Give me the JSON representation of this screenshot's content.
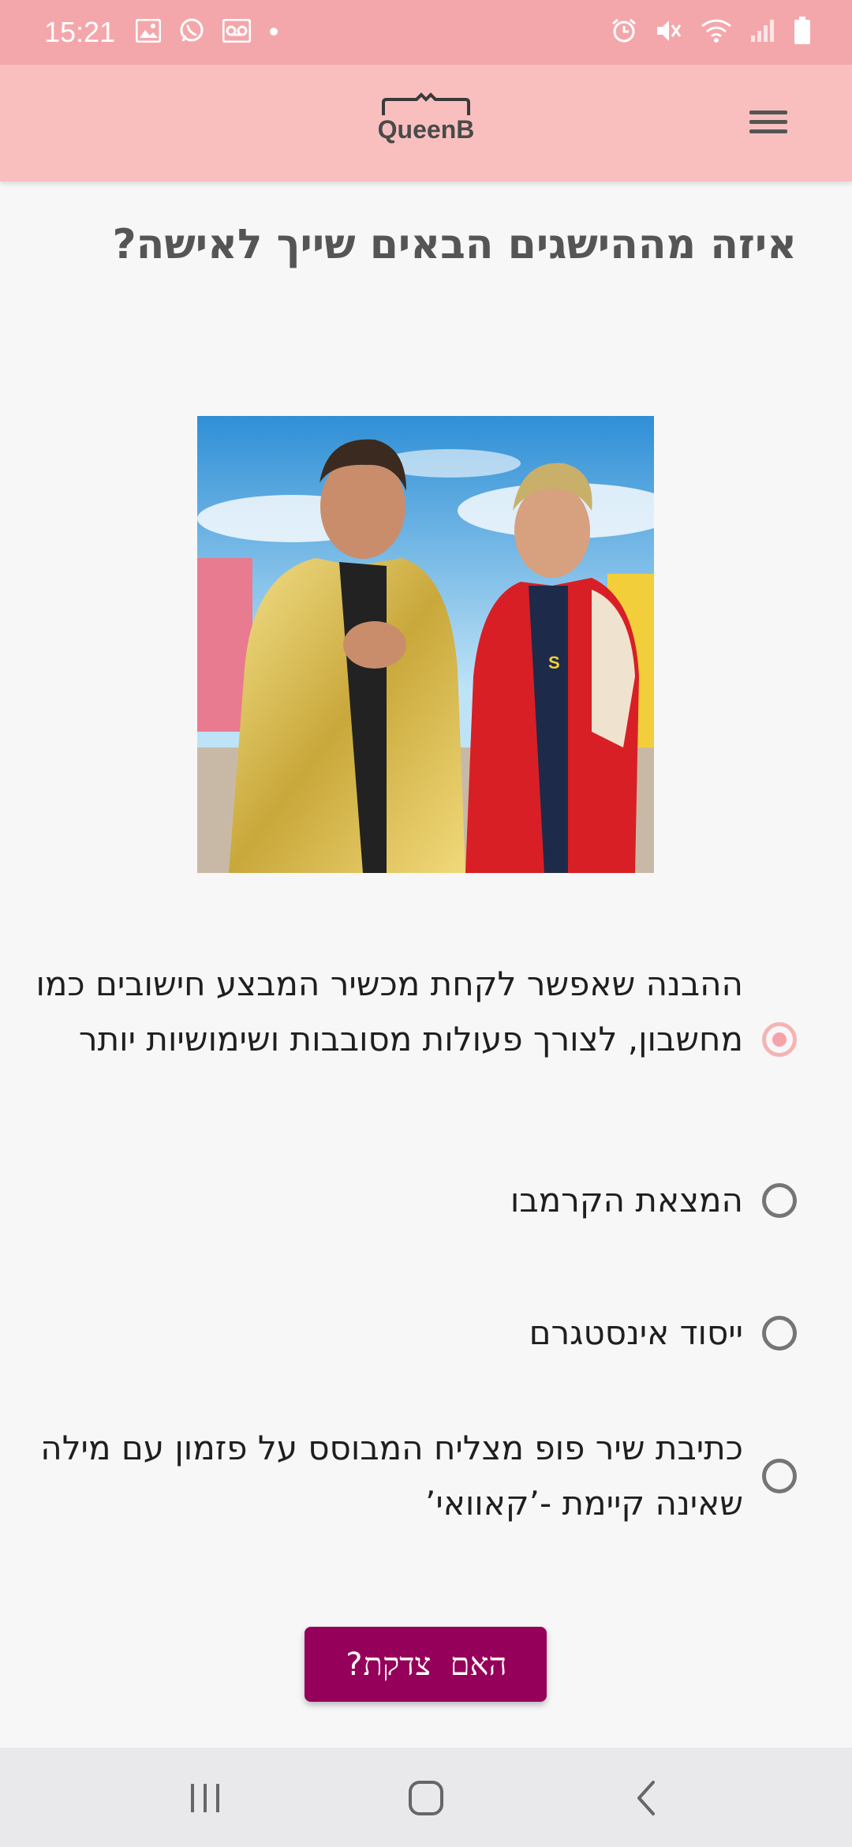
{
  "status_bar": {
    "time": "15:21",
    "left_icons": [
      "image-icon",
      "whatsapp-icon",
      "voicemail-icon",
      "dot-icon"
    ],
    "right_icons": [
      "alarm-icon",
      "mute-icon",
      "wifi-icon",
      "signal-icon",
      "battery-icon"
    ]
  },
  "app_bar": {
    "logo_text": "QueenB",
    "menu_icon": "hamburger-menu-icon"
  },
  "question": {
    "title": "איזה מההישגים הבאים שייך לאישה?"
  },
  "options": [
    {
      "label": "ההבנה שאפשר לקחת מכשיר המבצע חישובים כמו מחשבון, לצורך פעולות מסובבות ושימושיות יותר",
      "selected": true
    },
    {
      "label": "המצאת הקרמבו",
      "selected": false
    },
    {
      "label": "ייסוד אינסטגרם",
      "selected": false
    },
    {
      "label": "כתיבת שיר פופ מצליח המבוסס על פזמון עם מילה שאינה קיימת -’קאוואי’",
      "selected": false
    }
  ],
  "submit": {
    "label": "האם צדקת?",
    "color": "#95005a"
  },
  "colors": {
    "status_bar": "#f4a7ab",
    "app_bar": "#f9bfbf",
    "selected_radio": "#f4a3a8",
    "background": "#f7f7f8"
  },
  "nav_bar": {
    "icons": [
      "recent-apps-icon",
      "home-icon",
      "back-icon"
    ]
  }
}
